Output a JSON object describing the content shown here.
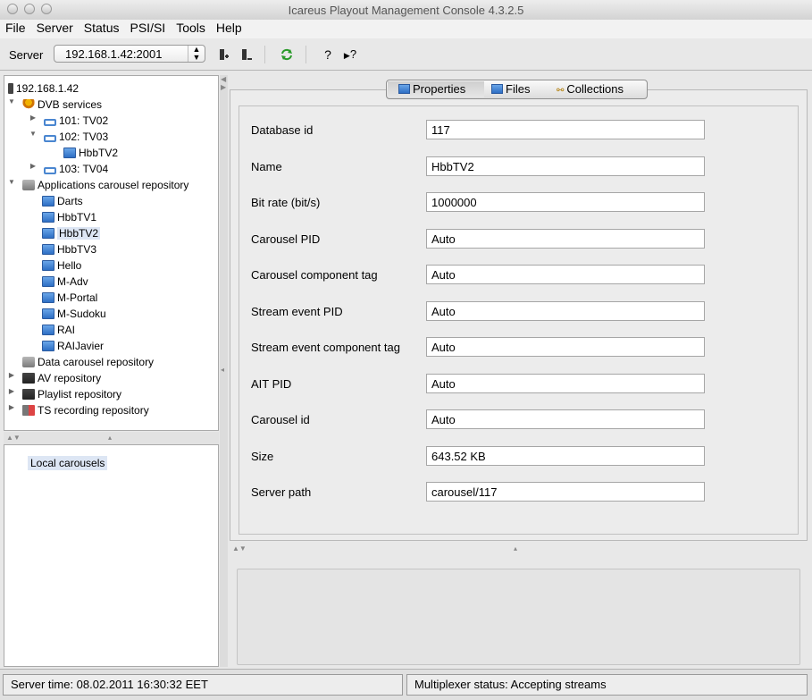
{
  "window": {
    "title": "Icareus Playout Management Console 4.3.2.5"
  },
  "menu": [
    "File",
    "Server",
    "Status",
    "PSI/SI",
    "Tools",
    "Help"
  ],
  "toolbar": {
    "server_label": "Server",
    "server_value": "192.168.1.42:2001",
    "help_glyph": "?",
    "context_help_glyph": "?"
  },
  "tree": {
    "root": "192.168.1.42",
    "dvb": "DVB services",
    "svc1": "101: TV02",
    "svc2": "102: TV03",
    "svc2_child": "HbbTV2",
    "svc3": "103: TV04",
    "apps": "Applications carousel repository",
    "app_items": [
      "Darts",
      "HbbTV1",
      "HbbTV2",
      "HbbTV3",
      "Hello",
      "M-Adv",
      "M-Portal",
      "M-Sudoku",
      "RAI",
      "RAIJavier"
    ],
    "data_repo": "Data carousel repository",
    "av_repo": "AV repository",
    "playlist_repo": "Playlist repository",
    "ts_repo": "TS recording repository"
  },
  "local": {
    "item": "Local carousels"
  },
  "tabs": [
    "Properties",
    "Files",
    "Collections"
  ],
  "properties": [
    {
      "label": "Database id",
      "value": "117"
    },
    {
      "label": "Name",
      "value": "HbbTV2"
    },
    {
      "label": "Bit rate (bit/s)",
      "value": "1000000"
    },
    {
      "label": "Carousel PID",
      "value": "Auto"
    },
    {
      "label": "Carousel component tag",
      "value": "Auto"
    },
    {
      "label": "Stream event PID",
      "value": "Auto"
    },
    {
      "label": "Stream event component tag",
      "value": "Auto"
    },
    {
      "label": "AIT PID",
      "value": "Auto"
    },
    {
      "label": "Carousel id",
      "value": "Auto"
    },
    {
      "label": "Size",
      "value": "643.52 KB"
    },
    {
      "label": "Server path",
      "value": "carousel/117"
    }
  ],
  "status": {
    "server_time": "Server time: 08.02.2011 16:30:32 EET",
    "mux": "Multiplexer status: Accepting streams"
  },
  "colors": {
    "selection": "#dde6f4",
    "app_icon": "#2e6fc4"
  }
}
